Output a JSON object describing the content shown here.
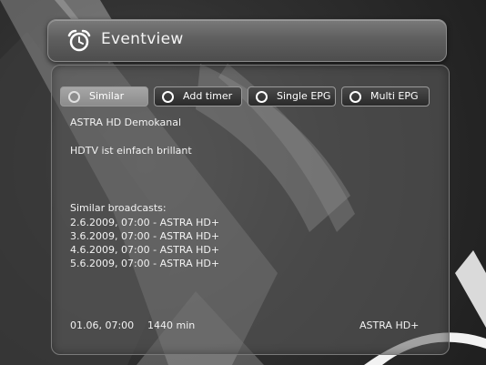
{
  "window": {
    "title": "Eventview",
    "title_icon": "alarm-clock-icon"
  },
  "buttons": [
    {
      "label": "Similar",
      "color": "#9a9a9a",
      "state": "dimmed"
    },
    {
      "label": "Add timer",
      "color": "#333333",
      "state": "normal"
    },
    {
      "label": "Single EPG",
      "color": "#333333",
      "state": "normal"
    },
    {
      "label": "Multi EPG",
      "color": "#333333",
      "state": "normal"
    }
  ],
  "event": {
    "channel": "ASTRA HD Demokanal",
    "description": "HDTV ist einfach brillant"
  },
  "similar": {
    "heading": "Similar broadcasts:",
    "items": [
      "2.6.2009, 07:00  -  ASTRA HD+",
      "3.6.2009, 07:00  -  ASTRA HD+",
      "4.6.2009, 07:00  -  ASTRA HD+",
      "5.6.2009, 07:00  -  ASTRA HD+"
    ]
  },
  "footer": {
    "start_time": "01.06, 07:00",
    "duration": "1440 min",
    "channel": "ASTRA HD+"
  }
}
